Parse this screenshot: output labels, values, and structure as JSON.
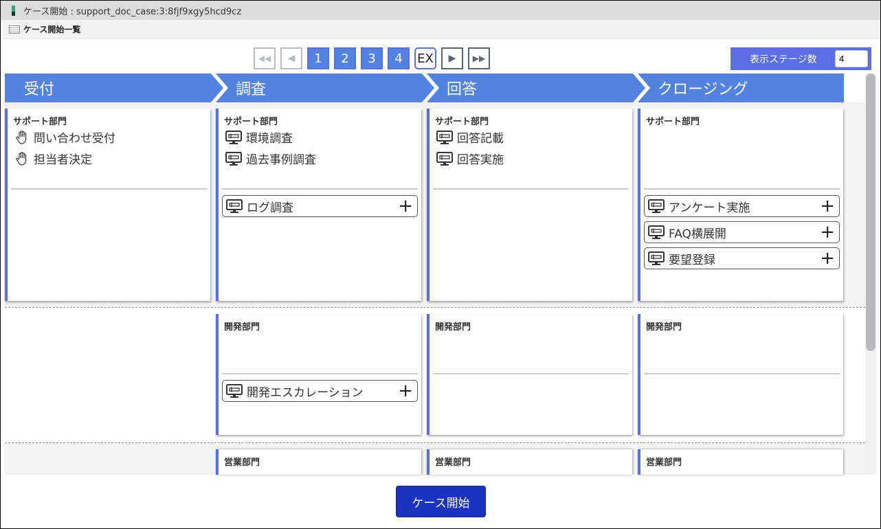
{
  "window": {
    "title": "ケース開始 : support_doc_case:3:8fjf9xgy5hcd9cz"
  },
  "subheader": {
    "label": "ケース開始一覧"
  },
  "pager": {
    "first": "◀◀",
    "prev": "◀",
    "pages": [
      "1",
      "2",
      "3",
      "4"
    ],
    "ex": "EX",
    "next": "▶",
    "last": "▶▶"
  },
  "stage_count": {
    "label": "表示ステージ数",
    "value": "4"
  },
  "stages": [
    "受付",
    "調査",
    "回答",
    "クロージング"
  ],
  "rows": [
    {
      "cells": [
        {
          "dept": "サポート部門",
          "tasks": [
            {
              "icon": "hand",
              "label": "問い合わせ受付"
            },
            {
              "icon": "hand",
              "label": "担当者決定"
            }
          ],
          "options": []
        },
        {
          "dept": "サポート部門",
          "tasks": [
            {
              "icon": "monitor",
              "label": "環境調査"
            },
            {
              "icon": "monitor",
              "label": "過去事例調査"
            }
          ],
          "options": [
            {
              "icon": "monitor",
              "label": "ログ調査"
            }
          ]
        },
        {
          "dept": "サポート部門",
          "tasks": [
            {
              "icon": "monitor",
              "label": "回答記載"
            },
            {
              "icon": "monitor",
              "label": "回答実施"
            }
          ],
          "options": []
        },
        {
          "dept": "サポート部門",
          "tasks": [],
          "options": [
            {
              "icon": "monitor",
              "label": "アンケート実施"
            },
            {
              "icon": "monitor",
              "label": "FAQ横展開"
            },
            {
              "icon": "monitor",
              "label": "要望登録"
            }
          ]
        }
      ]
    },
    {
      "cells": [
        null,
        {
          "dept": "開発部門",
          "tasks": [],
          "options": [
            {
              "icon": "monitor",
              "label": "開発エスカレーション"
            }
          ]
        },
        {
          "dept": "開発部門",
          "tasks": [],
          "options": []
        },
        {
          "dept": "開発部門",
          "tasks": [],
          "options": []
        }
      ]
    },
    {
      "cells": [
        null,
        {
          "dept": "営業部門",
          "tasks": [],
          "options": []
        },
        {
          "dept": "営業部門",
          "tasks": [],
          "options": []
        },
        {
          "dept": "営業部門",
          "tasks": [],
          "options": []
        }
      ]
    }
  ],
  "start_button": "ケース開始",
  "colors": {
    "stage": "#5383e0",
    "accent": "#5a6ee6",
    "button": "#1b33c0"
  }
}
